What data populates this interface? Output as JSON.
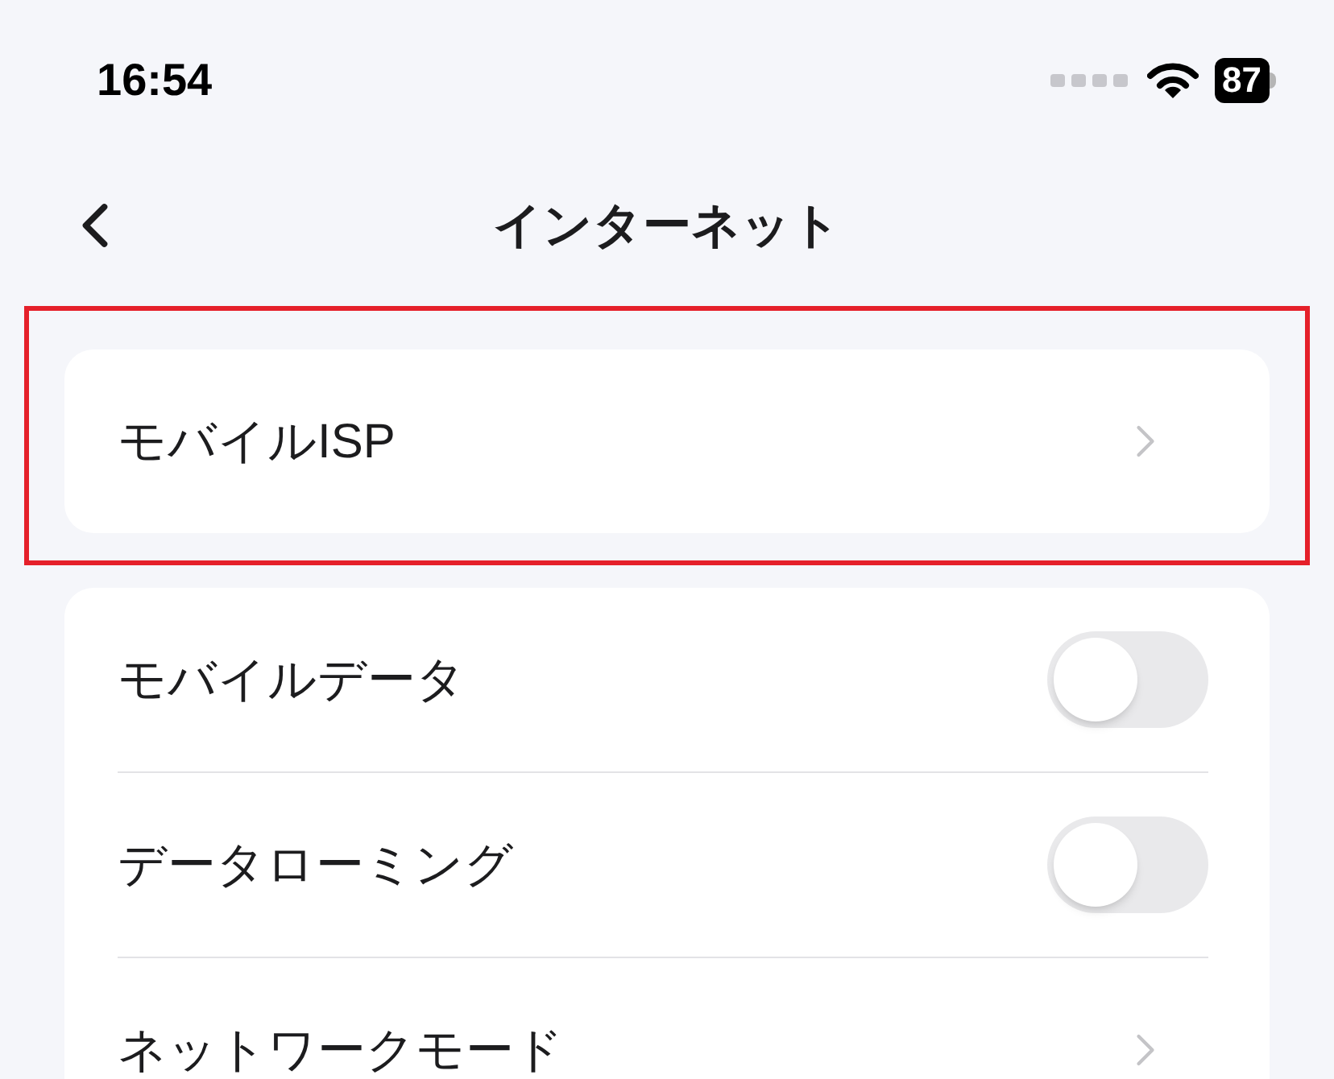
{
  "status_bar": {
    "time": "16:54",
    "battery": "87"
  },
  "header": {
    "title": "インターネット"
  },
  "groups": [
    {
      "highlighted": true,
      "rows": [
        {
          "kind": "link",
          "label": "モバイルISP"
        }
      ]
    },
    {
      "highlighted": false,
      "rows": [
        {
          "kind": "toggle",
          "label": "モバイルデータ",
          "on": false
        },
        {
          "kind": "toggle",
          "label": "データローミング",
          "on": false
        },
        {
          "kind": "link",
          "label": "ネットワークモード"
        }
      ]
    }
  ]
}
